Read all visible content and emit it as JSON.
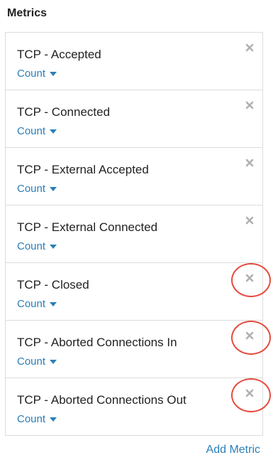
{
  "section_title": "Metrics",
  "metrics": [
    {
      "label": "TCP - Accepted",
      "aggregation": "Count",
      "highlighted": false
    },
    {
      "label": "TCP - Connected",
      "aggregation": "Count",
      "highlighted": false
    },
    {
      "label": "TCP - External Accepted",
      "aggregation": "Count",
      "highlighted": false
    },
    {
      "label": "TCP - External Connected",
      "aggregation": "Count",
      "highlighted": false
    },
    {
      "label": "TCP - Closed",
      "aggregation": "Count",
      "highlighted": true
    },
    {
      "label": "TCP - Aborted Connections In",
      "aggregation": "Count",
      "highlighted": true
    },
    {
      "label": "TCP - Aborted Connections Out",
      "aggregation": "Count",
      "highlighted": true
    }
  ],
  "add_metric_label": "Add Metric",
  "colors": {
    "link": "#2a7fb8",
    "remove_icon": "#b0b0b0",
    "highlight_ring": "#e64a3c",
    "border": "#dcdcdc"
  },
  "icons": {
    "remove": "close-icon",
    "aggregation_dropdown": "caret-down-icon"
  }
}
